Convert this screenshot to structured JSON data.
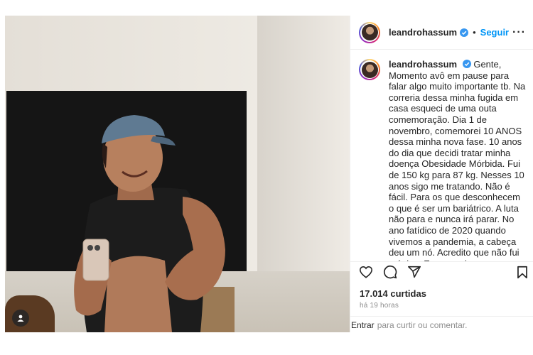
{
  "post": {
    "username": "leandrohassum",
    "follow_label": "Seguir",
    "separator": "•",
    "more_icon": "more-horizontal-icon",
    "caption": "Gente,\nMomento avô em pause para falar algo muito importante tb. Na correria dessa minha fugida em casa esqueci de uma outa comemoração. Dia 1 de novembro, comemorei 10 ANOS dessa minha nova fase. 10 anos do dia que decidi tratar minha doença Obesidade Mórbida. Fui de 150 kg para 87 kg. Nesses 10 anos sigo me tratando. Não é fácil. Para os que desconhecem o que é ser um bariátrico. A luta não para e nunca irá parar. No ano fatídico de 2020 quando vivemos a pandemia, a cabeça deu um nó. Acredito que não fui o único. E comecei mesmo seguindo minha rotina de exercícios a me descontrolar e isso acarretou num",
    "likes": "17.014 curtidas",
    "time_ago": "há 19 horas",
    "login_link": "Entrar",
    "login_text": "para curtir ou comentar."
  },
  "icons": {
    "like": "heart-icon",
    "comment": "comment-icon",
    "share": "share-icon",
    "save": "bookmark-icon",
    "verified": "verified-badge-icon",
    "user_tag": "user-tag-icon"
  },
  "colors": {
    "link_blue": "#0095f6",
    "text": "#262626",
    "muted": "#8e8e8e",
    "verified_blue": "#3897f0"
  }
}
